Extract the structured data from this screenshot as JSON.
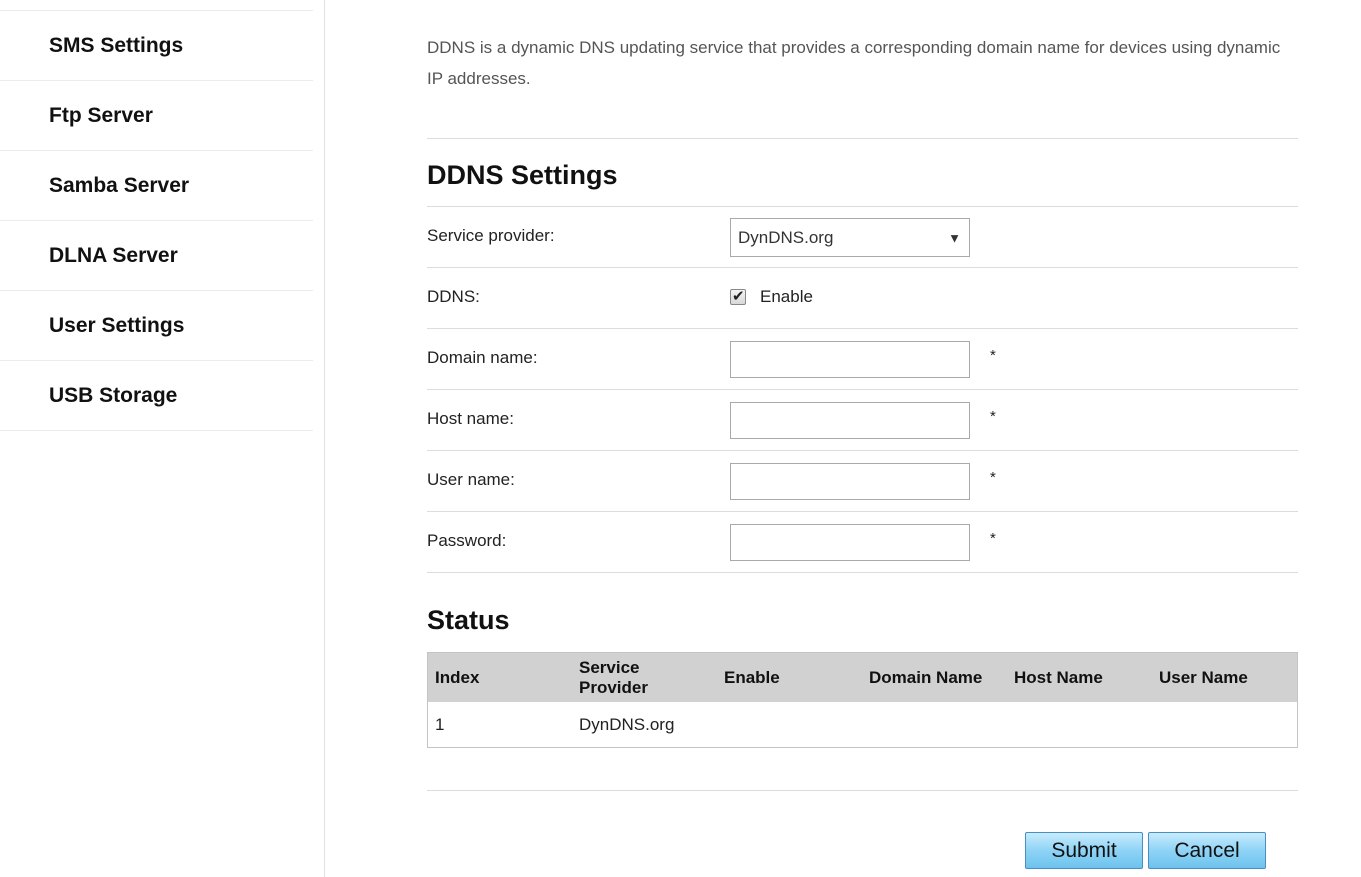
{
  "sidebar": {
    "items": [
      {
        "label": "SMS Settings"
      },
      {
        "label": "Ftp Server"
      },
      {
        "label": "Samba Server"
      },
      {
        "label": "DLNA Server"
      },
      {
        "label": "User Settings"
      },
      {
        "label": "USB Storage"
      }
    ]
  },
  "intro": {
    "text": "DDNS is a dynamic DNS updating service that provides a corresponding domain name for devices using dynamic IP addresses."
  },
  "ddns_settings": {
    "title": "DDNS Settings",
    "service_provider_label": "Service provider:",
    "service_provider_value": "DynDNS.org",
    "ddns_label": "DDNS:",
    "enable_label": "Enable",
    "enable_checked": true,
    "domain_name_label": "Domain name:",
    "domain_name_value": "",
    "host_name_label": "Host name:",
    "host_name_value": "",
    "user_name_label": "User name:",
    "user_name_value": "",
    "password_label": "Password:",
    "password_value": "",
    "required_mark": "*"
  },
  "status": {
    "title": "Status",
    "columns": [
      "Index",
      "Service Provider",
      "Enable",
      "Domain Name",
      "Host Name",
      "User Name"
    ],
    "rows": [
      [
        "1",
        "DynDNS.org",
        "",
        "",
        "",
        ""
      ]
    ]
  },
  "buttons": {
    "submit_label": "Submit",
    "cancel_label": "Cancel"
  },
  "colors": {
    "button_gradient_top": "#c7ecfd",
    "button_gradient_bottom": "#6cc3ee",
    "table_header_bg": "#d1d1d1"
  }
}
